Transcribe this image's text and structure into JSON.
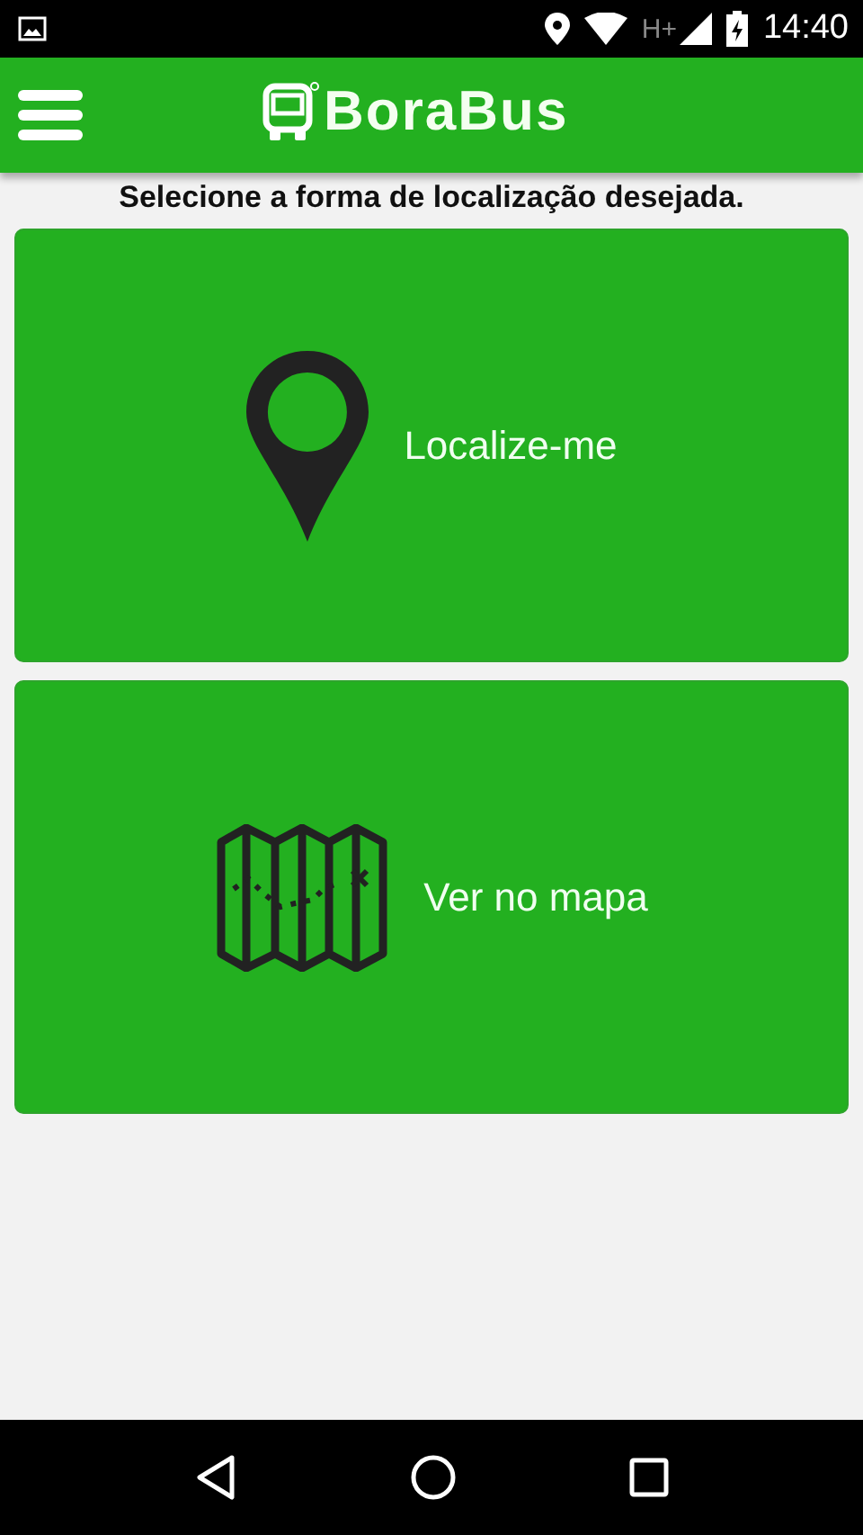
{
  "status_bar": {
    "time": "14:40",
    "network": "H+"
  },
  "app_bar": {
    "title": "BoraBus"
  },
  "instruction": "Selecione a forma de localização desejada.",
  "options": [
    {
      "kind": "locate",
      "label": "Localize-me"
    },
    {
      "kind": "map",
      "label": "Ver no mapa"
    }
  ]
}
